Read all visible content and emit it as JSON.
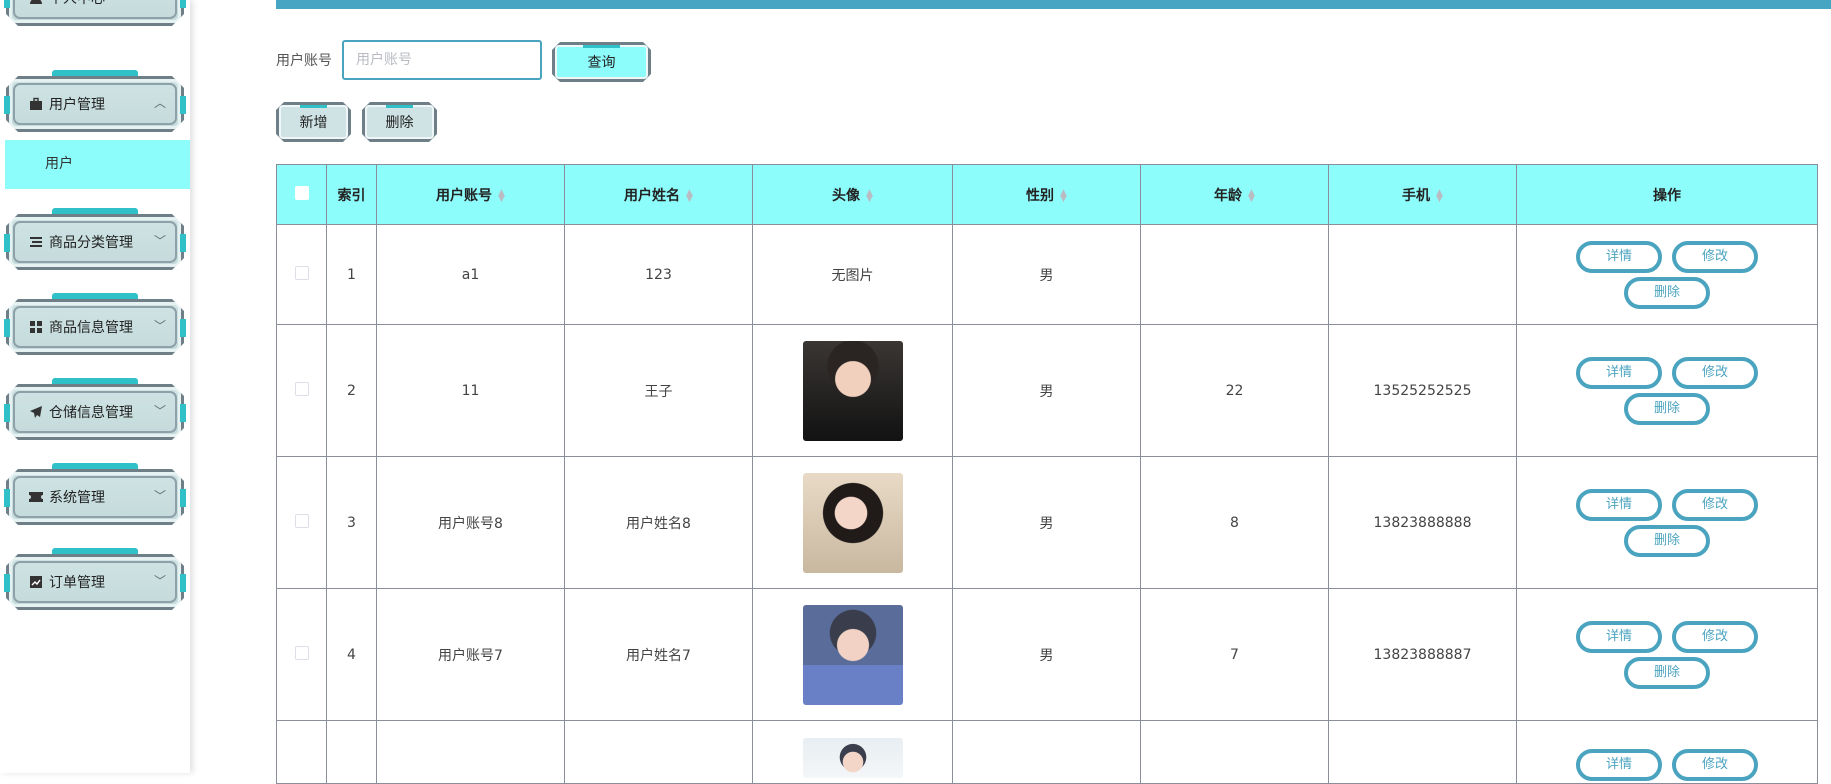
{
  "sidebar": {
    "items": [
      {
        "label": "个人中心",
        "icon": "user-icon",
        "expanded": false,
        "has_chevron": true
      },
      {
        "label": "用户管理",
        "icon": "briefcase-icon",
        "expanded": true,
        "has_chevron": true
      },
      {
        "label": "商品分类管理",
        "icon": "list-icon",
        "expanded": false,
        "has_chevron": true
      },
      {
        "label": "商品信息管理",
        "icon": "grid-icon",
        "expanded": false,
        "has_chevron": true
      },
      {
        "label": "仓储信息管理",
        "icon": "send-icon",
        "expanded": false,
        "has_chevron": true
      },
      {
        "label": "系统管理",
        "icon": "ticket-icon",
        "expanded": false,
        "has_chevron": true
      },
      {
        "label": "订单管理",
        "icon": "chart-icon",
        "expanded": false,
        "has_chevron": true
      }
    ],
    "submenu": {
      "label": "用户"
    },
    "colors": {
      "active_bg": "#8dfdfb",
      "accent": "#2fc0c8",
      "plate": "#cfe3e4"
    }
  },
  "search": {
    "label": "用户账号",
    "placeholder": "用户账号",
    "value": "",
    "query_label": "查询"
  },
  "toolbar": {
    "add_label": "新增",
    "delete_label": "删除"
  },
  "table": {
    "headers": {
      "index": "索引",
      "account": "用户账号",
      "name": "用户姓名",
      "avatar": "头像",
      "gender": "性别",
      "age": "年龄",
      "phone": "手机",
      "actions": "操作"
    },
    "rows": [
      {
        "index": "1",
        "account": "a1",
        "name": "123",
        "avatar": "无图片",
        "gender": "男",
        "age": "",
        "phone": ""
      },
      {
        "index": "2",
        "account": "11",
        "name": "王子",
        "avatar": "",
        "gender": "男",
        "age": "22",
        "phone": "13525252525"
      },
      {
        "index": "3",
        "account": "用户账号8",
        "name": "用户姓名8",
        "avatar": "",
        "gender": "男",
        "age": "8",
        "phone": "13823888888"
      },
      {
        "index": "4",
        "account": "用户账号7",
        "name": "用户姓名7",
        "avatar": "",
        "gender": "男",
        "age": "7",
        "phone": "13823888887"
      },
      {
        "index": "",
        "account": "",
        "name": "",
        "avatar": "",
        "gender": "",
        "age": "",
        "phone": ""
      }
    ],
    "actions": {
      "detail": "详情",
      "edit": "修改",
      "delete": "删除"
    }
  },
  "colors": {
    "header_bg": "#8dfdfb",
    "topbar": "#46a5c2",
    "outline_btn": "#4aa3bf"
  }
}
